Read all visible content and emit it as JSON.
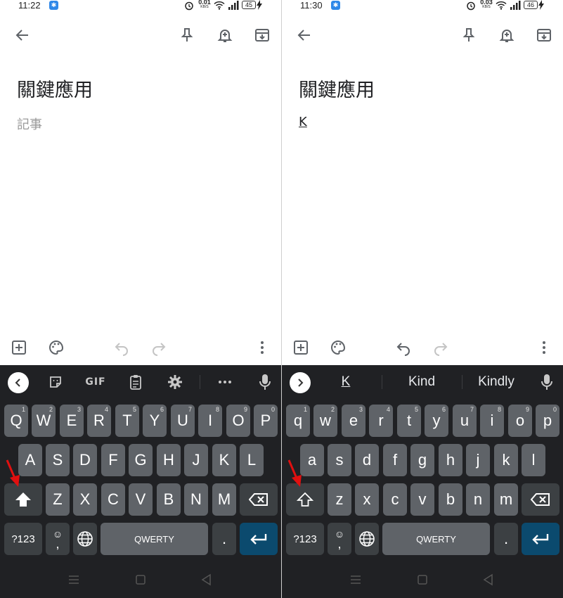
{
  "panels": [
    {
      "status": {
        "time": "11:22",
        "net_speed": "0.01",
        "net_unit": "KB/S",
        "battery": "45"
      },
      "note": {
        "title": "關鍵應用",
        "body": "記事"
      },
      "strip_suggestions": [],
      "keys": {
        "row1": [
          "Q",
          "W",
          "E",
          "R",
          "T",
          "Y",
          "U",
          "I",
          "O",
          "P"
        ],
        "row2": [
          "A",
          "S",
          "D",
          "F",
          "G",
          "H",
          "J",
          "K",
          "L"
        ],
        "row3": [
          "Z",
          "X",
          "C",
          "V",
          "B",
          "N",
          "M"
        ]
      }
    },
    {
      "status": {
        "time": "11:30",
        "net_speed": "0.03",
        "net_unit": "KB/S",
        "battery": "46"
      },
      "note": {
        "title": "關鍵應用",
        "body": "K"
      },
      "strip_suggestions": [
        "K",
        "Kind",
        "Kindly"
      ],
      "keys": {
        "row1": [
          "q",
          "w",
          "e",
          "r",
          "t",
          "y",
          "u",
          "i",
          "o",
          "p"
        ],
        "row2": [
          "a",
          "s",
          "d",
          "f",
          "g",
          "h",
          "j",
          "k",
          "l"
        ],
        "row3": [
          "z",
          "x",
          "c",
          "v",
          "b",
          "n",
          "m"
        ]
      }
    }
  ],
  "keyboard": {
    "number_hints": [
      "1",
      "2",
      "3",
      "4",
      "5",
      "6",
      "7",
      "8",
      "9",
      "0"
    ],
    "symbols_label": "?123",
    "comma_label": ",",
    "space_label": "QWERTY",
    "period_label": ".",
    "gif_label": "GIF"
  },
  "colors": {
    "keyboard_bg": "#202124",
    "key_bg": "#5f6368",
    "func_key_bg": "#3c4043",
    "enter_key_bg": "#0b4a6e",
    "annotation_arrow": "#e01010",
    "status_app_icon": "#2f88e8"
  },
  "icons": {
    "app_bar": [
      "back-arrow-icon",
      "pin-icon",
      "reminder-bell-icon",
      "archive-icon"
    ],
    "toolbar": [
      "add-box-icon",
      "palette-icon",
      "undo-icon",
      "redo-icon",
      "more-vert-icon"
    ],
    "strip_left": [
      "chevron-left-icon",
      "sticker-icon",
      "gif-icon",
      "clipboard-icon",
      "gear-icon",
      "more-horiz-icon",
      "mic-icon"
    ],
    "strip_right": [
      "chevron-right-icon",
      "mic-icon"
    ]
  }
}
